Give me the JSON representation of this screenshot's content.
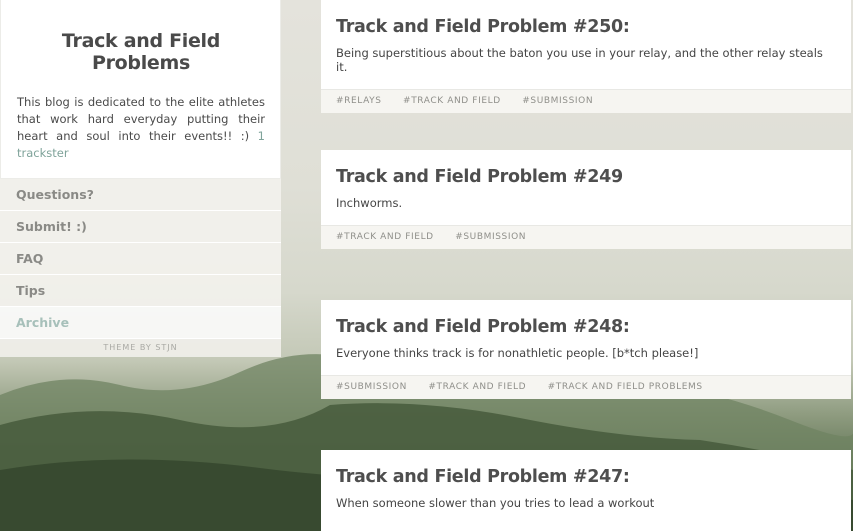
{
  "sidebar": {
    "title": "Track and Field Problems",
    "description": "This blog is dedicated to the elite athletes that work hard everyday putting their heart and soul into their events!! :)",
    "follower_link": "1 trackster",
    "nav": [
      {
        "label": "Questions?"
      },
      {
        "label": "Submit! :)"
      },
      {
        "label": "FAQ"
      },
      {
        "label": "Tips"
      },
      {
        "label": "Archive"
      }
    ],
    "theme_credit": "THEME BY STJN"
  },
  "posts": [
    {
      "title": "Track and Field Problem #250:",
      "body": "Being superstitious about the baton you use in your relay, and the other relay steals it.",
      "tags": [
        "#RELAYS",
        "#TRACK AND FIELD",
        "#SUBMISSION"
      ]
    },
    {
      "title": "Track and Field Problem #249",
      "body": "Inchworms.",
      "tags": [
        "#TRACK AND FIELD",
        "#SUBMISSION"
      ]
    },
    {
      "title": "Track and Field Problem #248:",
      "body": "Everyone thinks track is for nonathletic people. [b*tch please!]",
      "tags": [
        "#SUBMISSION",
        "#TRACK AND FIELD",
        "#TRACK AND FIELD PROBLEMS"
      ]
    },
    {
      "title": "Track and Field Problem #247:",
      "body": "When someone slower than you tries to lead a workout",
      "tags": []
    }
  ],
  "colors": {
    "accent_link": "#7fa39a",
    "title_text": "#4e4e4e",
    "tag_text": "#8f8f8a"
  }
}
